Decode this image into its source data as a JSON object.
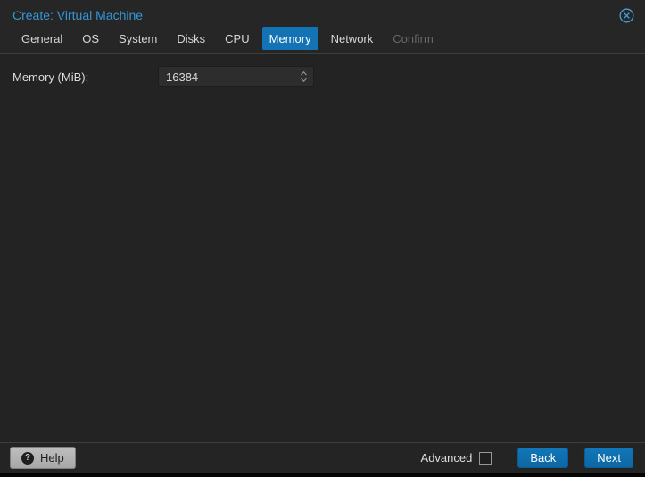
{
  "window": {
    "title": "Create: Virtual Machine"
  },
  "tabs": [
    {
      "label": "General",
      "state": ""
    },
    {
      "label": "OS",
      "state": ""
    },
    {
      "label": "System",
      "state": ""
    },
    {
      "label": "Disks",
      "state": ""
    },
    {
      "label": "CPU",
      "state": ""
    },
    {
      "label": "Memory",
      "state": "active"
    },
    {
      "label": "Network",
      "state": ""
    },
    {
      "label": "Confirm",
      "state": "disabled"
    }
  ],
  "form": {
    "memory_label": "Memory (MiB):",
    "memory_value": "16384"
  },
  "footer": {
    "help_label": "Help",
    "advanced_label": "Advanced",
    "advanced_checked": false,
    "back_label": "Back",
    "next_label": "Next"
  },
  "icons": {
    "help": "?",
    "close": "circle-x",
    "spinner": "up-down-chevrons"
  },
  "colors": {
    "title_text": "#3596d9",
    "active_tab": "#1373b5",
    "button_blue": "#0e6fae",
    "header_bg": "#262626",
    "content_bg": "#232323",
    "help_button_bg": "#b3b3b3"
  }
}
